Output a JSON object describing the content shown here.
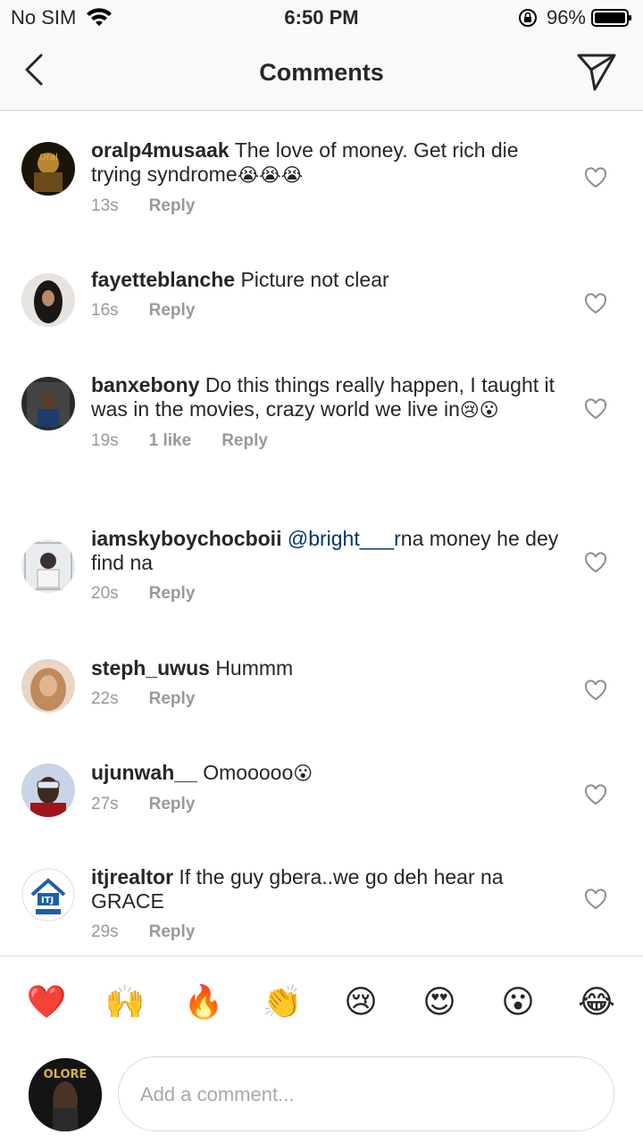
{
  "status_bar": {
    "carrier": "No SIM",
    "time": "6:50 PM",
    "battery": "96%"
  },
  "header": {
    "title": "Comments"
  },
  "comments": [
    {
      "username": "oralp4musaak",
      "text": "The love of money. Get rich die trying syndrome",
      "emoji": "😭😭😭",
      "time": "13s",
      "likes": "",
      "reply": "Reply"
    },
    {
      "username": "fayetteblanche",
      "text": "Picture not clear",
      "emoji": "",
      "time": "16s",
      "likes": "",
      "reply": "Reply"
    },
    {
      "username": "banxebony",
      "text": "Do this things really happen, I taught it was in the movies, crazy world we live in",
      "emoji": "😢😮",
      "time": "19s",
      "likes": "1 like",
      "reply": "Reply"
    },
    {
      "username": "iamskyboychocboii",
      "mention": "@bright___r",
      "text": "na money he dey find na",
      "emoji": "",
      "time": "20s",
      "likes": "",
      "reply": "Reply"
    },
    {
      "username": "steph_uwus",
      "text": "Hummm",
      "emoji": "",
      "time": "22s",
      "likes": "",
      "reply": "Reply"
    },
    {
      "username": "ujunwah__",
      "text": "Omooooo",
      "emoji": "😮",
      "time": "27s",
      "likes": "",
      "reply": "Reply"
    },
    {
      "username": "itjrealtor",
      "text": "If the guy gbera..we go deh hear na GRACE",
      "emoji": "",
      "time": "29s",
      "likes": "",
      "reply": "Reply"
    }
  ],
  "reactions": [
    "❤️",
    "🙌",
    "🔥",
    "👏",
    "😢",
    "😍",
    "😮",
    "😂"
  ],
  "composer": {
    "placeholder": "Add a comment...",
    "avatar_text": "OLORE"
  },
  "colors": {
    "mention": "#003569",
    "meta": "#999999",
    "text": "#262626",
    "heart_red": "#ed4956"
  }
}
